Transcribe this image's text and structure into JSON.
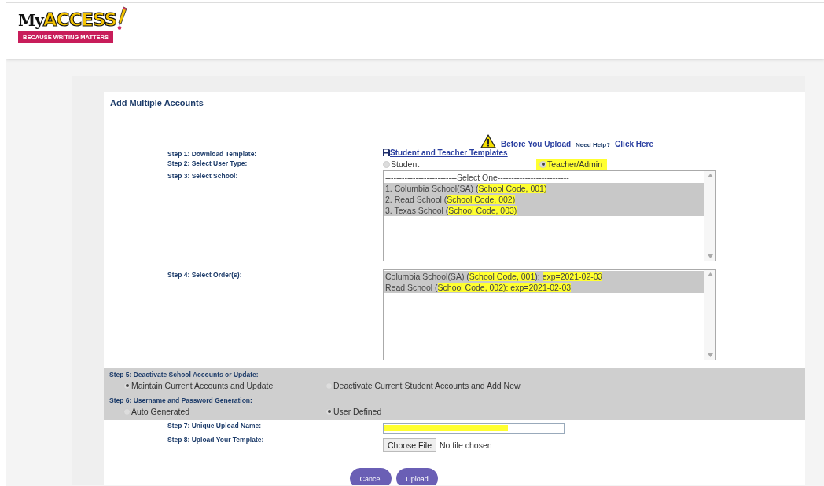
{
  "logo": {
    "wordmark_my": "My",
    "wordmark_access": "ACCESS",
    "tagline": "BECAUSE WRITING MATTERS"
  },
  "form": {
    "title": "Add Multiple Accounts",
    "help": {
      "warning_link": "Before You Upload",
      "need_help": "Need Help?",
      "help_link": "Click Here"
    },
    "steps": [
      {
        "label": "Step 1: Download Template:",
        "kind": "link",
        "link": "Student and Teacher Templates"
      },
      {
        "label": "Step 2: Select User Type:",
        "kind": "radio",
        "shaded": false,
        "options": [
          {
            "text": "Student",
            "selected": false,
            "highlighted": false
          },
          {
            "text": "Teacher/Admin",
            "selected": true,
            "highlighted": true
          }
        ]
      },
      {
        "label": "Step 3: Select School:",
        "kind": "listbox",
        "items": [
          {
            "parts": [
              {
                "text": "--------------------------Select One--------------------------",
                "highlighted": false
              }
            ],
            "selected": false
          },
          {
            "parts": [
              {
                "text": "1. Columbia School(SA) (",
                "highlighted": false
              },
              {
                "text": "School Code, 001)",
                "highlighted": true
              }
            ],
            "selected": true
          },
          {
            "parts": [
              {
                "text": "2. Read School (",
                "highlighted": false
              },
              {
                "text": "School Code, 002)",
                "highlighted": true
              }
            ],
            "selected": true
          },
          {
            "parts": [
              {
                "text": "3. Texas School (",
                "highlighted": false
              },
              {
                "text": "School Code, 003)",
                "highlighted": true
              }
            ],
            "selected": true
          }
        ]
      },
      {
        "label": "Step 4: Select Order(s):",
        "kind": "listbox",
        "items": [
          {
            "parts": [
              {
                "text": "Columbia School(SA) (",
                "highlighted": false
              },
              {
                "text": "School Code, 001",
                "highlighted": true
              },
              {
                "text": "): ",
                "highlighted": false
              },
              {
                "text": "exp=2021-02-03",
                "highlighted": true
              }
            ],
            "selected": true
          },
          {
            "parts": [
              {
                "text": "Read School (",
                "highlighted": false
              },
              {
                "text": "School Code, 002): exp=2021-02-03",
                "highlighted": true
              }
            ],
            "selected": true
          }
        ]
      },
      {
        "label": "Step 5: Deactivate School Accounts or Update:",
        "kind": "radio",
        "shaded": true,
        "options": [
          {
            "text": "Maintain Current Accounts and Update",
            "selected": true,
            "highlighted": false
          },
          {
            "text": "Deactivate Current Student Accounts and Add New",
            "selected": false,
            "highlighted": false
          }
        ]
      },
      {
        "label": "Step 6: Username and Password Generation:",
        "kind": "radio",
        "shaded": true,
        "options": [
          {
            "text": "Auto Generated",
            "selected": false,
            "highlighted": false
          },
          {
            "text": "User Defined",
            "selected": true,
            "highlighted": false
          }
        ]
      },
      {
        "label": "Step 7: Unique Upload Name:",
        "kind": "input",
        "highlighted": true
      },
      {
        "label": "Step 8: Upload Your Template:",
        "kind": "file",
        "button": "Choose File",
        "status": "No file chosen"
      }
    ]
  },
  "buttons": [
    "Cancel",
    "Upload"
  ]
}
